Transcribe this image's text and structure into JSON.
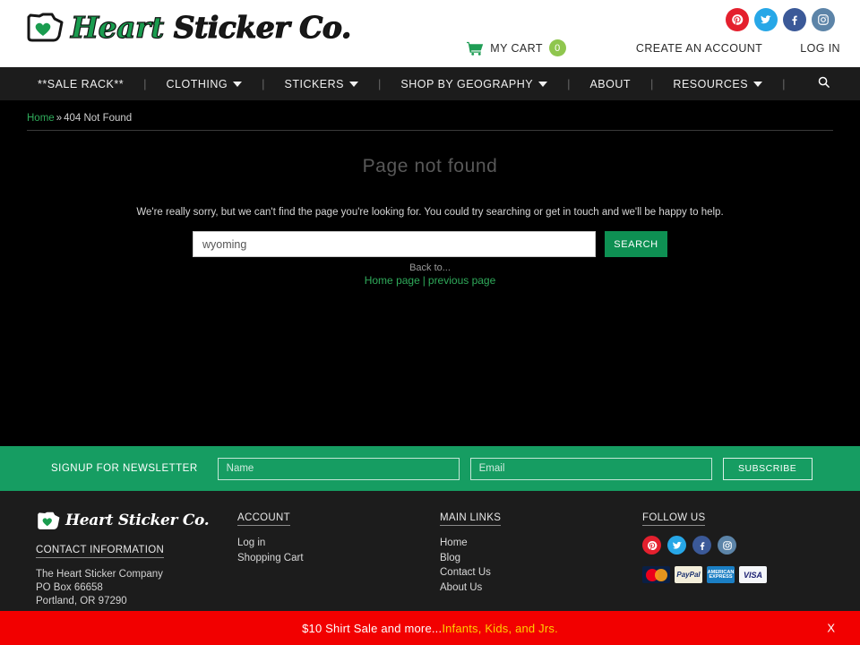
{
  "header": {
    "logo_text_green": "Heart",
    "logo_text_dark": "Sticker Co.",
    "logo_icon": "oregon-heart-icon",
    "social": [
      {
        "name": "pinterest-icon",
        "glyph": "P",
        "color": "#e4202e"
      },
      {
        "name": "twitter-icon",
        "glyph": "t",
        "color": "#27a7e7"
      },
      {
        "name": "facebook-icon",
        "glyph": "f",
        "color": "#3b5998"
      },
      {
        "name": "instagram-icon",
        "glyph": "▢",
        "color": "#5c84a8"
      }
    ],
    "cart_label": "MY CART",
    "cart_count": "0",
    "create_account": "CREATE AN ACCOUNT",
    "log_in": "LOG IN"
  },
  "nav": {
    "items": [
      {
        "label": "**SALE RACK**",
        "dropdown": false
      },
      {
        "label": "CLOTHING",
        "dropdown": true
      },
      {
        "label": "STICKERS",
        "dropdown": true
      },
      {
        "label": "SHOP BY GEOGRAPHY",
        "dropdown": true
      },
      {
        "label": "ABOUT",
        "dropdown": false
      },
      {
        "label": "RESOURCES",
        "dropdown": true
      }
    ],
    "search_icon": "search-icon"
  },
  "breadcrumb": {
    "home": "Home",
    "separator": "»",
    "current": "404 Not Found"
  },
  "main": {
    "title": "Page not found",
    "lead": "We're really sorry, but we can't find the page you're looking for. You could try searching or get in touch and we'll be happy to help.",
    "search_value": "wyoming",
    "search_placeholder": "",
    "search_button": "SEARCH",
    "back_to": "Back to...",
    "home_page_link": "Home page",
    "links_divider": "|",
    "previous_page_link": "previous page"
  },
  "newsletter": {
    "label": "SIGNUP FOR NEWSLETTER",
    "name_placeholder": "Name",
    "email_placeholder": "Email",
    "subscribe_label": "SUBSCRIBE"
  },
  "footer": {
    "logo_text": "Heart Sticker Co.",
    "contact_heading": "CONTACT INFORMATION",
    "address_line1": "The Heart Sticker Company",
    "address_line2": "PO Box 66658",
    "address_line3": "Portland, OR 97290",
    "account_heading": "ACCOUNT",
    "account_links": [
      "Log in",
      "Shopping Cart"
    ],
    "main_links_heading": "MAIN LINKS",
    "main_links": [
      "Home",
      "Blog",
      "Contact Us",
      "About Us"
    ],
    "follow_heading": "FOLLOW US",
    "payments": [
      {
        "name": "mastercard-icon",
        "label": "MasterCard"
      },
      {
        "name": "paypal-icon",
        "label": "PayPal"
      },
      {
        "name": "amex-icon",
        "label": "AMERICAN EXPRESS"
      },
      {
        "name": "visa-icon",
        "label": "VISA"
      }
    ]
  },
  "banner": {
    "text_plain": "$10 Shirt Sale and more...",
    "text_highlight": "Infants, Kids, and Jrs.",
    "close_label": "X"
  },
  "colors": {
    "brand_green": "#169d62",
    "accent_green": "#2faa5a",
    "search_green": "#0e9053",
    "banner_red": "#f20000",
    "banner_yellow": "#ffd000",
    "nav_dark": "#1c1c1c",
    "cart_badge": "#8fc64e"
  }
}
